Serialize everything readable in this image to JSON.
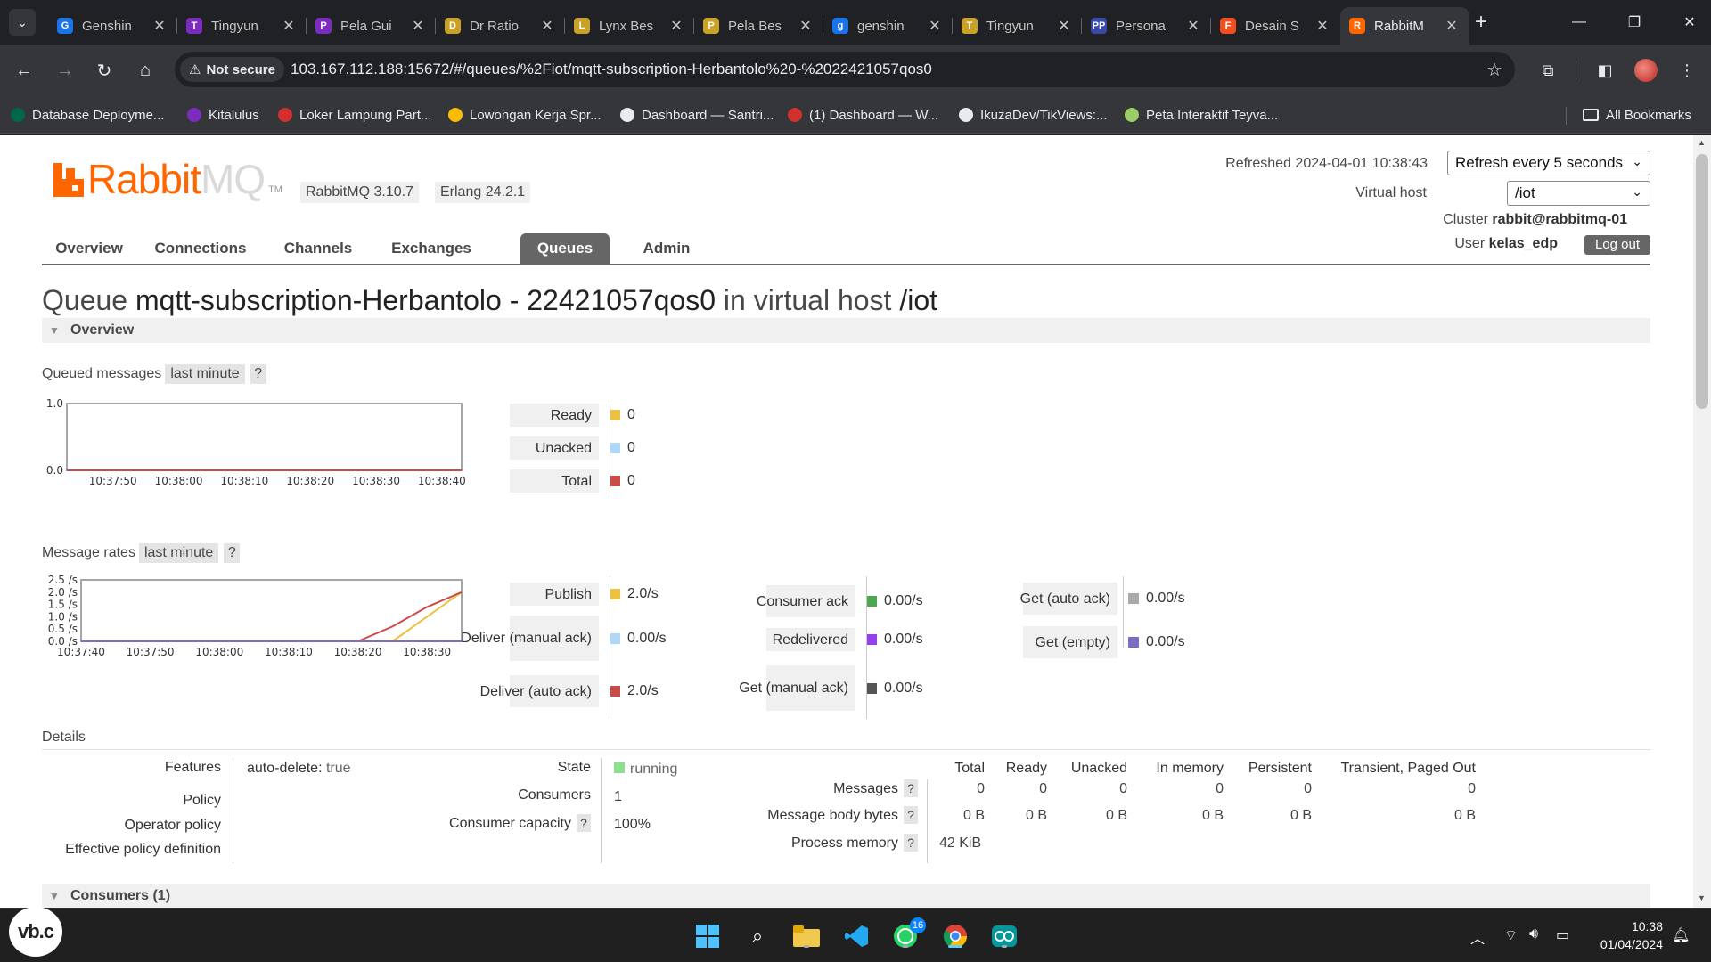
{
  "browser": {
    "tabs": [
      {
        "title": "Genshin",
        "color": "#1a73e8",
        "glyph": "G"
      },
      {
        "title": "Tingyun",
        "color": "#7b2cbf",
        "glyph": "T"
      },
      {
        "title": "Pela Gui",
        "color": "#7b2cbf",
        "glyph": "P"
      },
      {
        "title": "Dr Ratio",
        "color": "#c9a227",
        "glyph": "D"
      },
      {
        "title": "Lynx Bes",
        "color": "#c9a227",
        "glyph": "L"
      },
      {
        "title": "Pela Bes",
        "color": "#c9a227",
        "glyph": "P"
      },
      {
        "title": "genshin",
        "color": "#1a73e8",
        "glyph": "g"
      },
      {
        "title": "Tingyun",
        "color": "#c9a227",
        "glyph": "T"
      },
      {
        "title": "Persona",
        "color": "#3949ab",
        "glyph": "PP"
      },
      {
        "title": "Desain S",
        "color": "#f24e1e",
        "glyph": "F"
      },
      {
        "title": "RabbitM",
        "color": "#ff6600",
        "glyph": "R",
        "active": true
      }
    ],
    "not_secure_label": "Not secure",
    "url": "103.167.112.188:15672/#/queues/%2Fiot/mqtt-subscription-Herbantolo%20-%2022421057qos0",
    "bookmarks": [
      {
        "label": "Database Deployme...",
        "color": "#00684a"
      },
      {
        "label": "Kitalulus",
        "color": "#7b2cbf"
      },
      {
        "label": "Loker Lampung Part...",
        "color": "#d32f2f"
      },
      {
        "label": "Lowongan Kerja Spr...",
        "color": "#fbbc04"
      },
      {
        "label": "Dashboard — Santri...",
        "color": "#e8eaed"
      },
      {
        "label": "(1) Dashboard — W...",
        "color": "#d32f2f"
      },
      {
        "label": "IkuzaDev/TikViews:...",
        "color": "#e8eaed"
      },
      {
        "label": "Peta Interaktif Teyva...",
        "color": "#9ccc65"
      }
    ],
    "all_bookmarks": "All Bookmarks"
  },
  "header": {
    "logo_rabbit": "Rabbit",
    "logo_mq": "MQ",
    "logo_tm": "TM",
    "rabbitmq_version": "RabbitMQ 3.10.7",
    "erlang_version": "Erlang 24.2.1",
    "refreshed_label": "Refreshed 2024-04-01 10:38:43",
    "refresh_option": "Refresh every 5 seconds",
    "virtual_host_label": "Virtual host",
    "virtual_host_value": "/iot",
    "cluster_label": "Cluster",
    "cluster_value": "rabbit@rabbitmq-01",
    "user_label": "User",
    "user_value": "kelas_edp",
    "logout_label": "Log out"
  },
  "nav": {
    "tabs": [
      "Overview",
      "Connections",
      "Channels",
      "Exchanges",
      "Queues",
      "Admin"
    ],
    "active": "Queues"
  },
  "title": {
    "prefix": "Queue",
    "queue_name": "mqtt-subscription-Herbantolo - 22421057qos0",
    "middle": "in virtual host",
    "vhost": "/iot"
  },
  "overview": {
    "section_label": "Overview",
    "queued_label": "Queued messages",
    "range_label": "last minute",
    "help": "?",
    "queued_legend": [
      {
        "label": "Ready",
        "value": "0",
        "color": "#edc240"
      },
      {
        "label": "Unacked",
        "value": "0",
        "color": "#afd8f8"
      },
      {
        "label": "Total",
        "value": "0",
        "color": "#cb4b4b"
      }
    ],
    "rates_label": "Message rates",
    "rates_legend": [
      {
        "label": "Publish",
        "value": "2.0/s",
        "color": "#edc240"
      },
      {
        "label": "Deliver (manual ack)",
        "value": "0.00/s",
        "color": "#afd8f8"
      },
      {
        "label": "Deliver (auto ack)",
        "value": "2.0/s",
        "color": "#cb4b4b"
      },
      {
        "label": "Consumer ack",
        "value": "0.00/s",
        "color": "#4da74d"
      },
      {
        "label": "Redelivered",
        "value": "0.00/s",
        "color": "#9440ed"
      },
      {
        "label": "Get (manual ack)",
        "value": "0.00/s",
        "color": "#555555"
      },
      {
        "label": "Get (auto ack)",
        "value": "0.00/s",
        "color": "#aaaaaa"
      },
      {
        "label": "Get (empty)",
        "value": "0.00/s",
        "color": "#7e6ec2"
      }
    ]
  },
  "chart_data": [
    {
      "type": "line",
      "title": "Queued messages",
      "x": [
        "10:37:50",
        "10:38:00",
        "10:38:10",
        "10:38:20",
        "10:38:30",
        "10:38:40"
      ],
      "xlim": [
        "10:37:43",
        "10:38:43"
      ],
      "ylim": [
        0,
        1.0
      ],
      "yticks": [
        "0.0",
        "1.0"
      ],
      "series": [
        {
          "name": "Ready",
          "color": "#edc240",
          "points": [
            [
              "10:37:43",
              0
            ],
            [
              "10:38:43",
              0
            ]
          ]
        },
        {
          "name": "Unacked",
          "color": "#afd8f8",
          "points": [
            [
              "10:37:43",
              0
            ],
            [
              "10:38:43",
              0
            ]
          ]
        },
        {
          "name": "Total",
          "color": "#cb4b4b",
          "points": [
            [
              "10:37:43",
              0
            ],
            [
              "10:38:43",
              0
            ]
          ]
        }
      ],
      "grid": false
    },
    {
      "type": "line",
      "title": "Message rates",
      "x": [
        "10:37:40",
        "10:37:50",
        "10:38:00",
        "10:38:10",
        "10:38:20",
        "10:38:30"
      ],
      "xlim": [
        "10:37:40",
        "10:38:35"
      ],
      "ylim": [
        0,
        2.5
      ],
      "yticks": [
        "0.0 /s",
        "0.5 /s",
        "1.0 /s",
        "1.5 /s",
        "2.0 /s",
        "2.5 /s"
      ],
      "series": [
        {
          "name": "Publish",
          "color": "#edc240",
          "points": [
            [
              "10:38:25",
              0
            ],
            [
              "10:38:35",
              2.0
            ]
          ]
        },
        {
          "name": "Deliver (auto ack)",
          "color": "#cb4b4b",
          "points": [
            [
              "10:38:20",
              0
            ],
            [
              "10:38:25",
              0.6
            ],
            [
              "10:38:30",
              1.4
            ],
            [
              "10:38:35",
              2.0
            ]
          ]
        },
        {
          "name": "Get (empty)",
          "color": "#7e6ec2",
          "points": [
            [
              "10:37:40",
              0
            ],
            [
              "10:38:35",
              0
            ]
          ]
        }
      ],
      "grid": false
    }
  ],
  "details": {
    "section_label": "Details",
    "features_label": "Features",
    "features_key": "auto-delete:",
    "features_val": "true",
    "policy_label": "Policy",
    "operator_policy_label": "Operator policy",
    "effective_policy_label": "Effective policy definition",
    "state_label": "State",
    "state_value": "running",
    "state_color": "#8ce08c",
    "consumers_label": "Consumers",
    "consumers_value": "1",
    "capacity_label": "Consumer capacity",
    "capacity_value": "100%",
    "table_headers": [
      "Total",
      "Ready",
      "Unacked",
      "In memory",
      "Persistent",
      "Transient, Paged Out"
    ],
    "rows": [
      {
        "label": "Messages",
        "values": [
          "0",
          "0",
          "0",
          "0",
          "0",
          "0"
        ]
      },
      {
        "label": "Message body bytes",
        "values": [
          "0 B",
          "0 B",
          "0 B",
          "0 B",
          "0 B",
          "0 B"
        ]
      },
      {
        "label": "Process memory",
        "values": [
          "42 KiB"
        ]
      }
    ]
  },
  "consumers_section": "Consumers (1)",
  "taskbar": {
    "badge_count": "16",
    "time": "10:38",
    "date": "01/04/2024",
    "corner_logo": "vb.c"
  }
}
